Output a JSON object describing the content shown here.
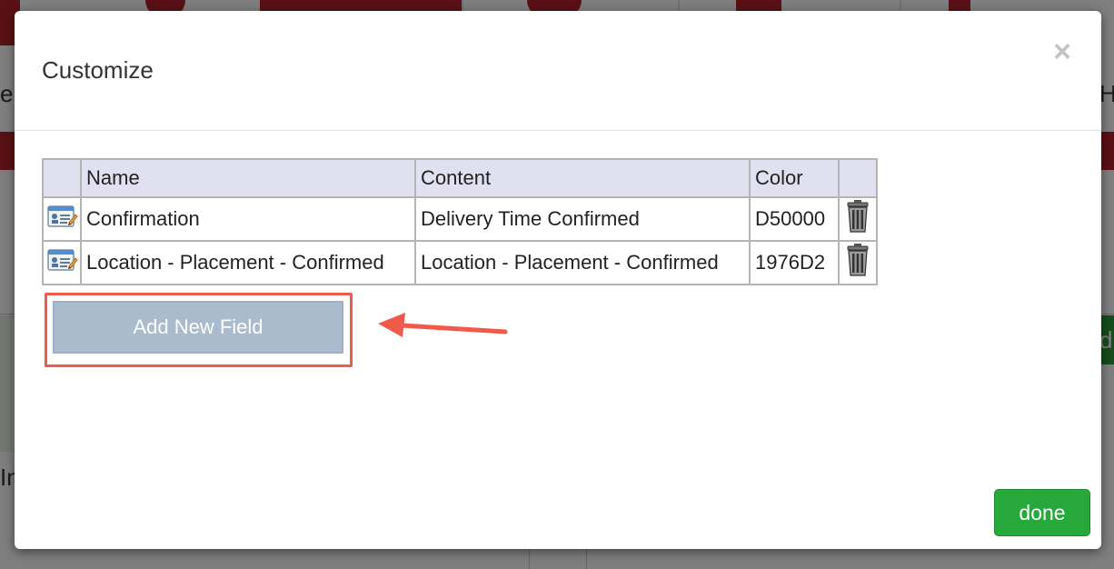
{
  "modal": {
    "title": "Customize",
    "close_label": "×",
    "table": {
      "headers": [
        "",
        "Name",
        "Content",
        "Color",
        ""
      ],
      "rows": [
        {
          "name": "Confirmation",
          "content": "Delivery Time Confirmed",
          "color": "D50000"
        },
        {
          "name": "Location - Placement - Confirmed",
          "content": "Location - Placement - Confirmed",
          "color": "1976D2"
        }
      ]
    },
    "add_button_label": "Add New Field",
    "done_button_label": "done"
  },
  "icons": {
    "edit": "edit-card-icon",
    "delete": "trash-icon",
    "close": "close-icon",
    "annotation": "arrow-annotation"
  },
  "colors": {
    "header_bg": "#e0e0f0",
    "add_button_bg": "#a9bbcc",
    "done_button_bg": "#27a83a",
    "highlight": "#f05a4b",
    "background_accent": "#b4232c"
  }
}
